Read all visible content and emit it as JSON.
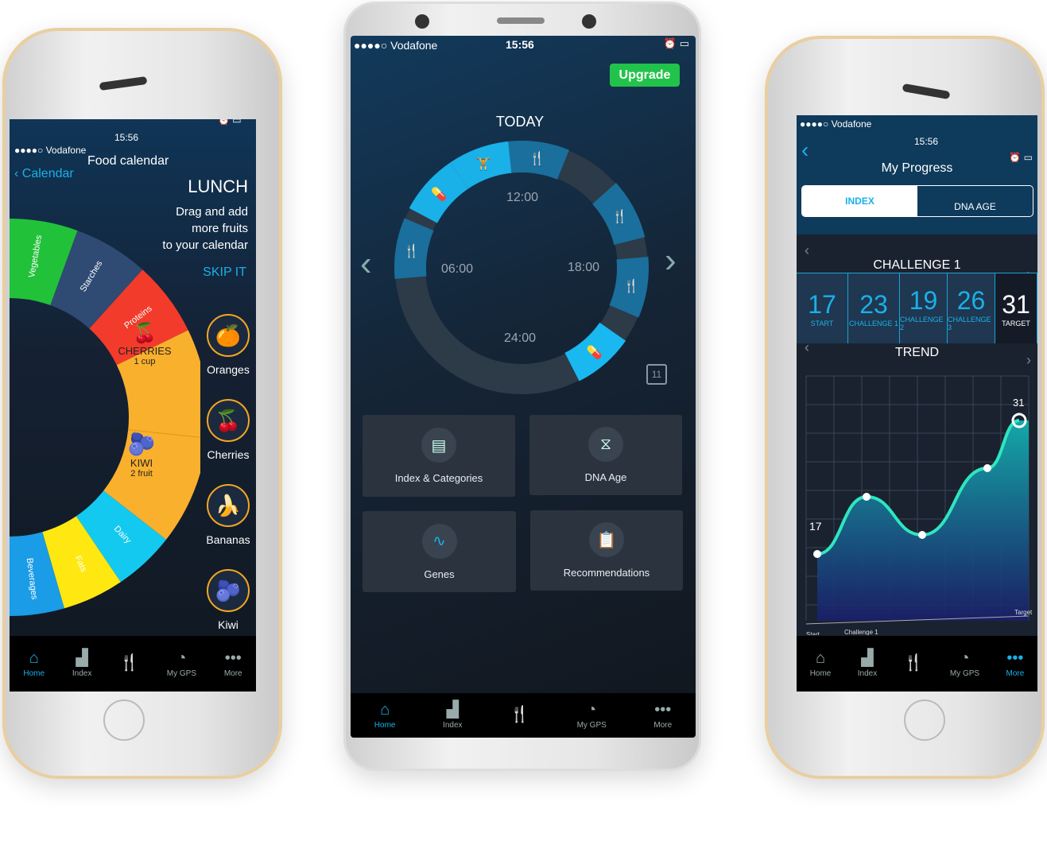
{
  "status": {
    "carrier": "Vodafone",
    "time": "15:56"
  },
  "left_phone": {
    "back_label": "Calendar",
    "title": "Food calendar",
    "meal": "LUNCH",
    "instruction_lines": [
      "Drag and add",
      "more fruits",
      "to your calendar"
    ],
    "skip_label": "SKIP IT",
    "wheel": [
      {
        "label": "Vegetables",
        "color": "#22c13a"
      },
      {
        "label": "Starches",
        "color": "#2f4a73"
      },
      {
        "label": "Proteins",
        "color": "#f23b2b"
      },
      {
        "label": "",
        "color": "#f9b02c"
      },
      {
        "label": "Dairy",
        "color": "#14c9ef"
      },
      {
        "label": "Fats",
        "color": "#ffe812"
      },
      {
        "label": "Beverages",
        "color": "#1a9ce6"
      }
    ],
    "wheel_items": [
      {
        "name": "CHERRIES",
        "qty": "1 cup",
        "icon": "🍒"
      },
      {
        "name": "KIWI",
        "qty": "2 fruit",
        "icon": "🫐"
      }
    ],
    "fruits": [
      {
        "label": "Oranges",
        "icon": "🍊"
      },
      {
        "label": "Cherries",
        "icon": "🍒"
      },
      {
        "label": "Bananas",
        "icon": "🍌"
      },
      {
        "label": "Kiwi",
        "icon": "🫐"
      }
    ]
  },
  "center_phone": {
    "upgrade_label": "Upgrade",
    "upgrade_color": "#22c34a",
    "today_label": "TODAY",
    "clock_labels": {
      "top": "12:00",
      "left": "06:00",
      "right": "18:00",
      "bottom": "24:00"
    },
    "calendar_day": "11",
    "tiles": [
      {
        "label": "Index & Categories",
        "icon": "report-icon"
      },
      {
        "label": "DNA Age",
        "icon": "dna-icon"
      },
      {
        "label": "Genes",
        "icon": "wave-icon"
      },
      {
        "label": "Recommendations",
        "icon": "clipboard-icon"
      }
    ]
  },
  "right_phone": {
    "title": "My Progress",
    "tabs": [
      {
        "label": "INDEX",
        "active": true
      },
      {
        "label": "DNA AGE",
        "active": false
      }
    ],
    "challenge_title": "CHALLENGE 1",
    "stats": [
      {
        "value": "17",
        "label": "START"
      },
      {
        "value": "23",
        "label": "CHALLENGE 1"
      },
      {
        "value": "19",
        "label": "CHALLENGE 2"
      },
      {
        "value": "26",
        "label": "CHALLENGE 3"
      },
      {
        "value": "31",
        "label": "TARGET"
      }
    ],
    "trend_title": "TREND",
    "chart_data": {
      "type": "area",
      "x": [
        "Start",
        "Challenge 1",
        "",
        "",
        "Target"
      ],
      "values": [
        17,
        23,
        19,
        26,
        31
      ],
      "point_labels": [
        "17",
        "31"
      ],
      "x_tick_labels": [
        "Start",
        "Challenge 1",
        "Target"
      ],
      "grid": true,
      "line_color": "#2ee6c0"
    }
  },
  "nav": [
    {
      "label": "Home",
      "icon": "home-icon"
    },
    {
      "label": "Index",
      "icon": "bar-chart-icon"
    },
    {
      "label": "",
      "icon": "fork-knife-icon"
    },
    {
      "label": "My GPS",
      "icon": "pie-icon"
    },
    {
      "label": "More",
      "icon": "more-icon"
    }
  ],
  "accent": "#1ab0e8"
}
